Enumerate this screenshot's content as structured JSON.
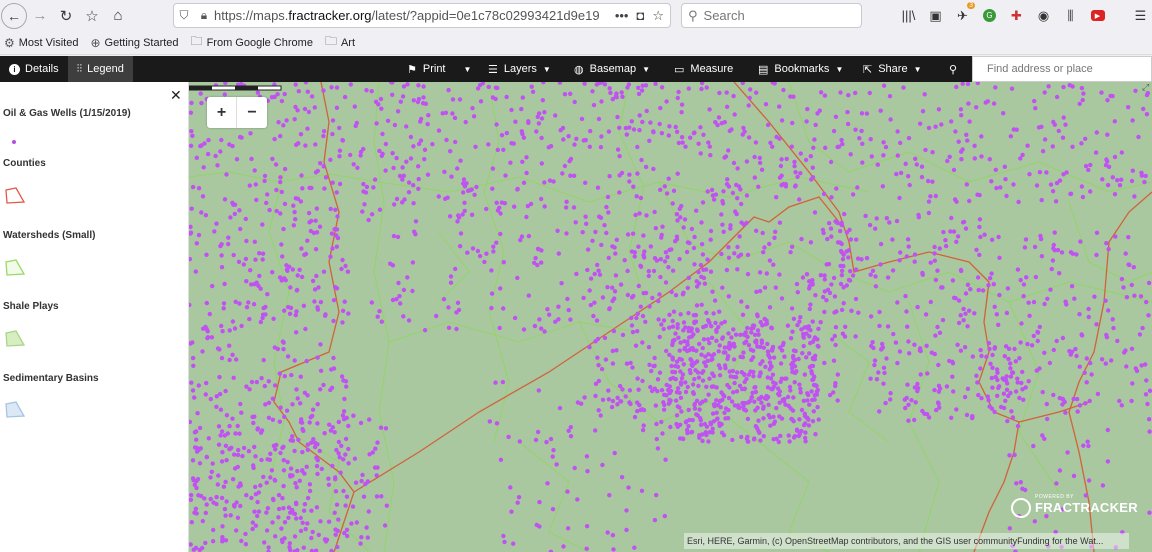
{
  "browser": {
    "url_prefix": "https://maps.",
    "url_domain": "fractracker.org",
    "url_path": "/latest/?appid=0e1c78c02993421d9e19",
    "url_more": "•••",
    "search_placeholder": "Search",
    "badge_count": "3"
  },
  "bookmarks": [
    {
      "label": "Most Visited",
      "icon": "gear-icon"
    },
    {
      "label": "Getting Started",
      "icon": "globe-icon"
    },
    {
      "label": "From Google Chrome",
      "icon": "folder-icon"
    },
    {
      "label": "Art",
      "icon": "folder-icon"
    }
  ],
  "header": {
    "details": "Details",
    "legend": "Legend",
    "print": "Print",
    "layers": "Layers",
    "basemap": "Basemap",
    "measure": "Measure",
    "bookmarks": "Bookmarks",
    "share": "Share",
    "address_placeholder": "Find address or place"
  },
  "legend": {
    "items": [
      {
        "title": "Oil & Gas Wells (1/15/2019)",
        "color": "#b84ee6"
      },
      {
        "title": "Counties",
        "color": "#e0584a"
      },
      {
        "title": "Watersheds (Small)",
        "color": "#9ad868"
      },
      {
        "title": "Shale Plays",
        "color": "#c4e6a8"
      },
      {
        "title": "Sedimentary Basins",
        "color": "#c8dcf0"
      }
    ]
  },
  "map": {
    "zoom_in": "+",
    "zoom_out": "−",
    "attribution": "Esri, HERE, Garmin, (c) OpenStreetMap contributors, and the GIS user community",
    "attribution_extra": "Funding for the Wat...",
    "powered_by": "POWERED BY",
    "logo": "FRACTRACKER",
    "well_color": "#bf52f0",
    "base_color": "#a9c8a0"
  }
}
